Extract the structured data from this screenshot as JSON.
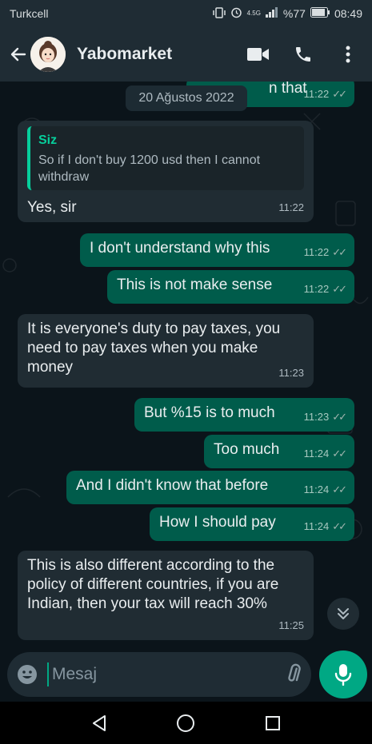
{
  "status_bar": {
    "carrier": "Turkcell",
    "network_badge": "4.5G",
    "battery": "%77",
    "time": "08:49"
  },
  "header": {
    "contact_name": "Yabomarket",
    "icons": [
      "back-arrow-icon",
      "avatar",
      "video-call-icon",
      "phone-icon",
      "more-vert-icon"
    ]
  },
  "chat": {
    "date_chip": "20 Ağustos 2022",
    "messages": [
      {
        "direction": "out",
        "text": "n that",
        "time": "11:22",
        "ticks": "✓✓"
      },
      {
        "direction": "in",
        "quote_author": "Siz",
        "quote_text": "So if I don't buy 1200 usd then I cannot withdraw",
        "text": "Yes, sir",
        "time": "11:22"
      },
      {
        "direction": "out",
        "text": "I don't understand why this",
        "time": "11:22",
        "ticks": "✓✓"
      },
      {
        "direction": "out",
        "text": "This is not make sense",
        "time": "11:22",
        "ticks": "✓✓"
      },
      {
        "direction": "in",
        "text": "It is everyone's duty to pay taxes, you need to pay taxes when you make money",
        "time": "11:23"
      },
      {
        "direction": "out",
        "text": "But %15 is to much",
        "time": "11:23",
        "ticks": "✓✓"
      },
      {
        "direction": "out",
        "text": "Too much",
        "time": "11:24",
        "ticks": "✓✓"
      },
      {
        "direction": "out",
        "text": "And I didn't know that before",
        "time": "11:24",
        "ticks": "✓✓"
      },
      {
        "direction": "out",
        "text": "How I should pay",
        "time": "11:24",
        "ticks": "✓✓"
      },
      {
        "direction": "in",
        "text": "This is also different according to the policy of different countries, if you are Indian, then your tax will reach 30%",
        "time": "11:25"
      }
    ]
  },
  "input": {
    "placeholder": "Mesaj"
  },
  "colors": {
    "background": "#0b141a",
    "incoming_bubble": "#202c33",
    "outgoing_bubble": "#005c4b",
    "accent": "#00a884",
    "quote_accent": "#06cf9c"
  }
}
